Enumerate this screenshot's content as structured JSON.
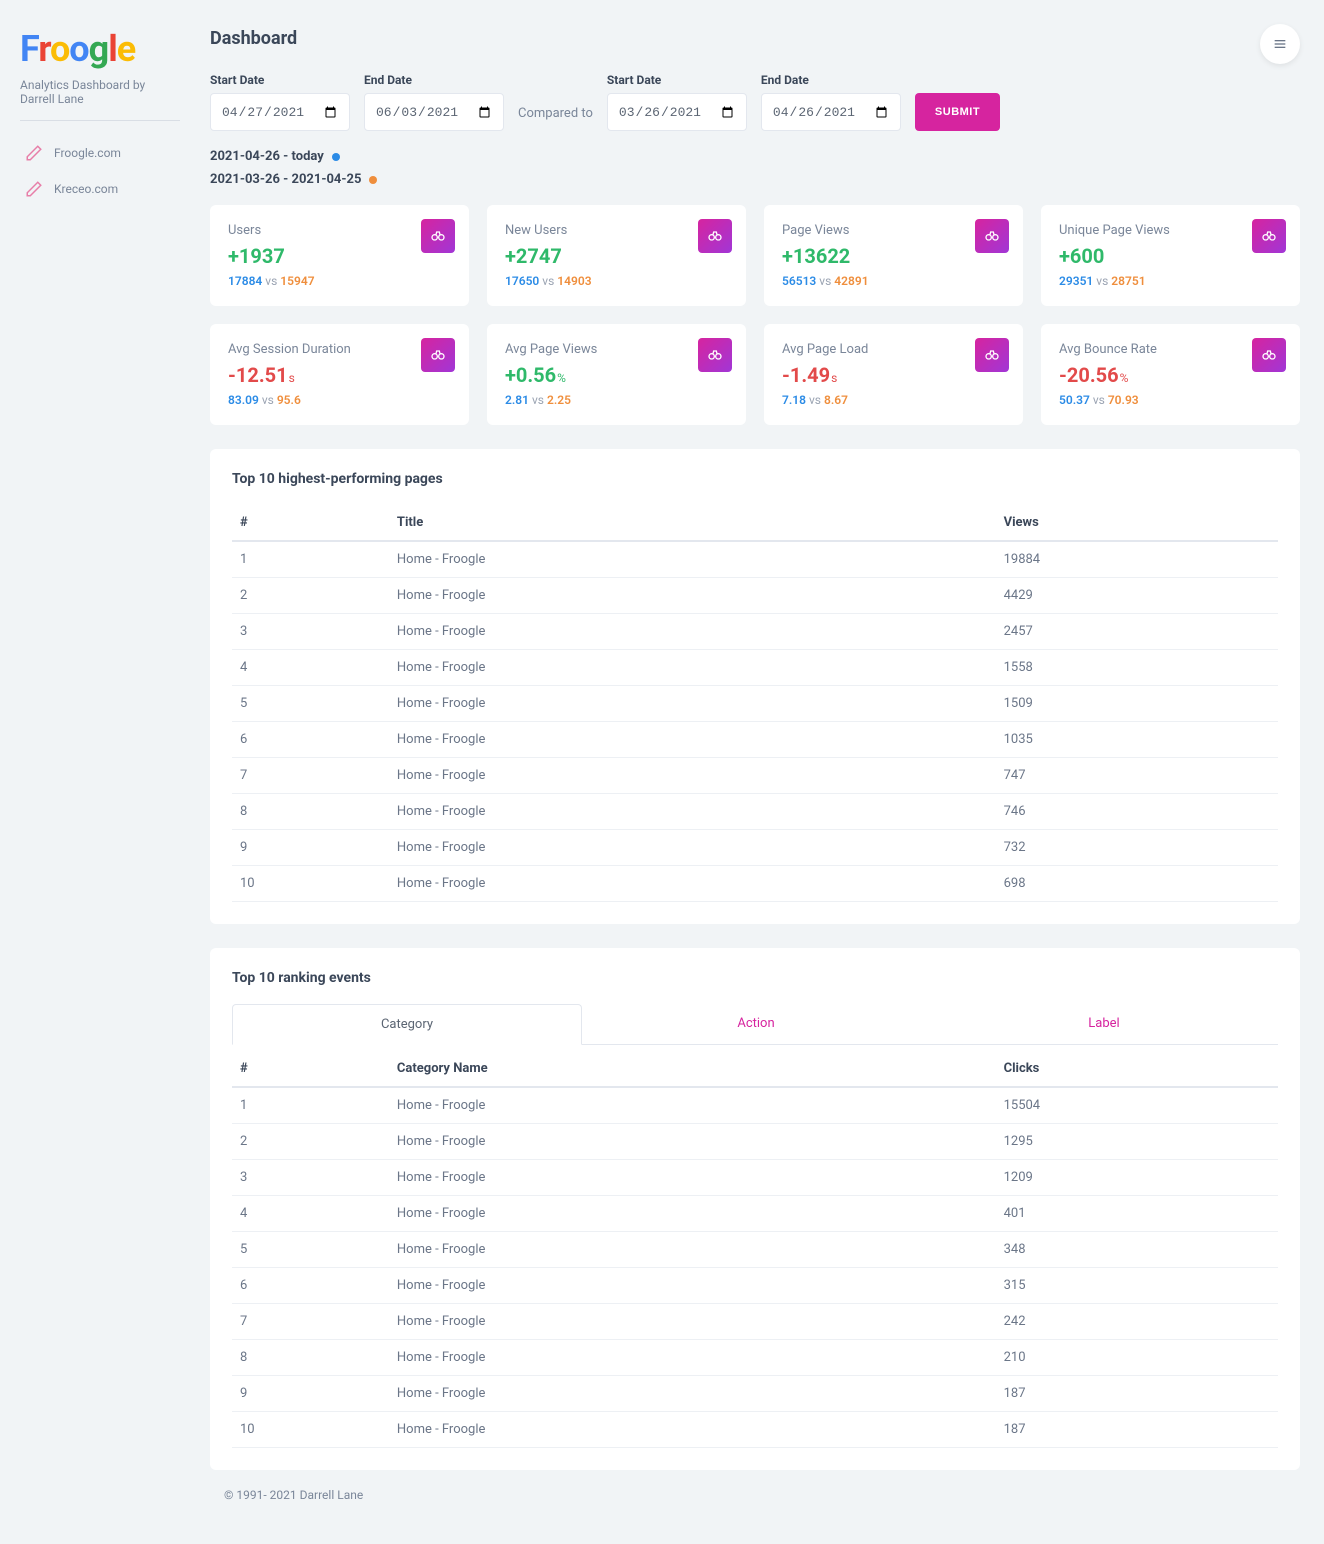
{
  "logo_chars": [
    "F",
    "r",
    "o",
    "o",
    "g",
    "l",
    "e"
  ],
  "tagline": "Analytics Dashboard by Darrell Lane",
  "sites": [
    {
      "label": "Froogle.com"
    },
    {
      "label": "Kreceo.com"
    }
  ],
  "page_title": "Dashboard",
  "date_labels": {
    "start": "Start Date",
    "end": "End Date",
    "compared": "Compared to",
    "submit": "SUBMIT"
  },
  "dates": {
    "start1": "2021-04-27",
    "end1": "2021-06-03",
    "start2": "2021-03-26",
    "end2": "2021-04-26"
  },
  "ranges": {
    "current": "2021-04-26 - today",
    "previous": "2021-03-26 - 2021-04-25"
  },
  "metrics": [
    {
      "title": "Users",
      "delta": "+1937",
      "unit": "",
      "dir": "up",
      "cur": "17884",
      "prev": "15947"
    },
    {
      "title": "New Users",
      "delta": "+2747",
      "unit": "",
      "dir": "up",
      "cur": "17650",
      "prev": "14903"
    },
    {
      "title": "Page Views",
      "delta": "+13622",
      "unit": "",
      "dir": "up",
      "cur": "56513",
      "prev": "42891"
    },
    {
      "title": "Unique Page Views",
      "delta": "+600",
      "unit": "",
      "dir": "up",
      "cur": "29351",
      "prev": "28751"
    },
    {
      "title": "Avg Session Duration",
      "delta": "-12.51",
      "unit": "s",
      "dir": "down",
      "cur": "83.09",
      "prev": "95.6"
    },
    {
      "title": "Avg Page Views",
      "delta": "+0.56",
      "unit": "%",
      "dir": "up",
      "cur": "2.81",
      "prev": "2.25"
    },
    {
      "title": "Avg Page Load",
      "delta": "-1.49",
      "unit": "s",
      "dir": "down",
      "cur": "7.18",
      "prev": "8.67"
    },
    {
      "title": "Avg Bounce Rate",
      "delta": "-20.56",
      "unit": "%",
      "dir": "down",
      "cur": "50.37",
      "prev": "70.93"
    }
  ],
  "vs_label": "vs",
  "top_pages": {
    "heading": "Top 10 highest-performing pages",
    "columns": {
      "num": "#",
      "title": "Title",
      "views": "Views"
    },
    "rows": [
      {
        "n": "1",
        "title": "Home - Froogle",
        "views": "19884"
      },
      {
        "n": "2",
        "title": "Home - Froogle",
        "views": "4429"
      },
      {
        "n": "3",
        "title": "Home - Froogle",
        "views": "2457"
      },
      {
        "n": "4",
        "title": "Home - Froogle",
        "views": "1558"
      },
      {
        "n": "5",
        "title": "Home - Froogle",
        "views": "1509"
      },
      {
        "n": "6",
        "title": "Home - Froogle",
        "views": "1035"
      },
      {
        "n": "7",
        "title": "Home - Froogle",
        "views": "747"
      },
      {
        "n": "8",
        "title": "Home - Froogle",
        "views": "746"
      },
      {
        "n": "9",
        "title": "Home - Froogle",
        "views": "732"
      },
      {
        "n": "10",
        "title": "Home - Froogle",
        "views": "698"
      }
    ]
  },
  "events": {
    "heading": "Top 10 ranking events",
    "tabs": {
      "category": "Category",
      "action": "Action",
      "label": "Label"
    },
    "columns": {
      "num": "#",
      "name": "Category Name",
      "clicks": "Clicks"
    },
    "rows": [
      {
        "n": "1",
        "title": "Home - Froogle",
        "clicks": "15504"
      },
      {
        "n": "2",
        "title": "Home - Froogle",
        "clicks": "1295"
      },
      {
        "n": "3",
        "title": "Home - Froogle",
        "clicks": "1209"
      },
      {
        "n": "4",
        "title": "Home - Froogle",
        "clicks": "401"
      },
      {
        "n": "5",
        "title": "Home - Froogle",
        "clicks": "348"
      },
      {
        "n": "6",
        "title": "Home - Froogle",
        "clicks": "315"
      },
      {
        "n": "7",
        "title": "Home - Froogle",
        "clicks": "242"
      },
      {
        "n": "8",
        "title": "Home - Froogle",
        "clicks": "210"
      },
      {
        "n": "9",
        "title": "Home - Froogle",
        "clicks": "187"
      },
      {
        "n": "10",
        "title": "Home - Froogle",
        "clicks": "187"
      }
    ]
  },
  "footer": "© 1991- 2021 Darrell Lane"
}
